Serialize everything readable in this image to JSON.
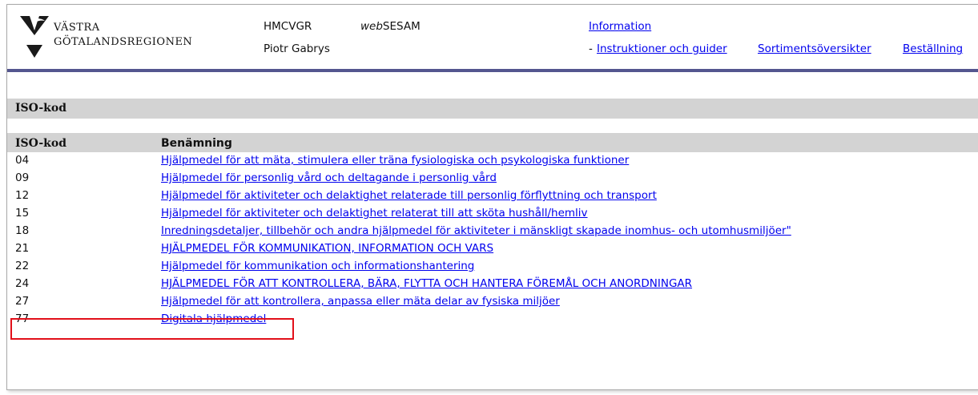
{
  "header": {
    "org_line1": "VÄSTRA",
    "org_line2": "GÖTALANDSREGIONEN",
    "system": "HMCVGR",
    "app_prefix": "web",
    "app_suffix": "SESAM",
    "user": "Piotr Gabrys",
    "info_link": "Information",
    "dash": "-",
    "links": [
      "Instruktioner och guider",
      "Sortimentsöversikter",
      "Beställning"
    ]
  },
  "section": {
    "title": "ISO-kod"
  },
  "table": {
    "headers": [
      "ISO-kod",
      "Benämning"
    ],
    "rows": [
      {
        "code": "04",
        "name": "Hjälpmedel för att mäta, stimulera eller träna fysiologiska och psykologiska funktioner"
      },
      {
        "code": "09",
        "name": "Hjälpmedel för personlig vård och deltagande i personlig vård"
      },
      {
        "code": "12",
        "name": "Hjälpmedel för aktiviteter och delaktighet relaterade till personlig förflyttning och transport"
      },
      {
        "code": "15",
        "name": "Hjälpmedel för aktiviteter och delaktighet relaterat till att sköta hushåll/hemliv"
      },
      {
        "code": "18",
        "name": "Inredningsdetaljer, tillbehör och andra hjälpmedel för aktiviteter i mänskligt skapade inomhus- och utomhusmiljöer\""
      },
      {
        "code": "21",
        "name": "HJÄLPMEDEL FÖR KOMMUNIKATION, INFORMATION OCH VARS"
      },
      {
        "code": "22",
        "name": "Hjälpmedel för kommunikation och informationshantering"
      },
      {
        "code": "24",
        "name": "HJÄLPMEDEL FÖR ATT KONTROLLERA, BÄRA, FLYTTA OCH HANTERA FÖREMÅL OCH ANORDNINGAR"
      },
      {
        "code": "27",
        "name": "Hjälpmedel för att kontrollera, anpassa eller mäta delar av fysiska miljöer"
      },
      {
        "code": "77",
        "name": "Digitala hjälpmedel"
      }
    ]
  },
  "colors": {
    "link": "#0000ee",
    "header_rule": "#54568f",
    "band": "#d3d3d3",
    "highlight": "#e2101a"
  }
}
